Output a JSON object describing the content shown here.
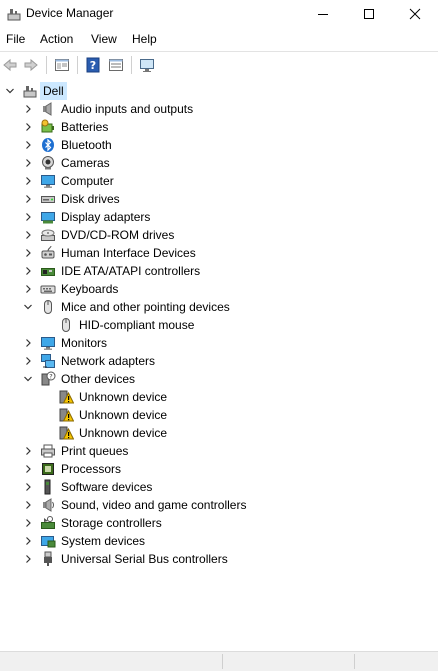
{
  "window": {
    "title": "Device Manager"
  },
  "menu": [
    "File",
    "Action",
    "View",
    "Help"
  ],
  "tree": {
    "root": "Dell",
    "categories": [
      {
        "label": "Audio inputs and outputs",
        "icon": "speaker-icon",
        "expanded": false
      },
      {
        "label": "Batteries",
        "icon": "battery-icon",
        "expanded": false
      },
      {
        "label": "Bluetooth",
        "icon": "bluetooth-icon",
        "expanded": false
      },
      {
        "label": "Cameras",
        "icon": "camera-icon",
        "expanded": false
      },
      {
        "label": "Computer",
        "icon": "computer-icon",
        "expanded": false
      },
      {
        "label": "Disk drives",
        "icon": "disk-drive-icon",
        "expanded": false
      },
      {
        "label": "Display adapters",
        "icon": "display-adapter-icon",
        "expanded": false
      },
      {
        "label": "DVD/CD-ROM drives",
        "icon": "dvd-drive-icon",
        "expanded": false
      },
      {
        "label": "Human Interface Devices",
        "icon": "hid-icon",
        "expanded": false
      },
      {
        "label": "IDE ATA/ATAPI controllers",
        "icon": "ide-controller-icon",
        "expanded": false
      },
      {
        "label": "Keyboards",
        "icon": "keyboard-icon",
        "expanded": false
      },
      {
        "label": "Mice and other pointing devices",
        "icon": "mouse-icon",
        "expanded": true,
        "children": [
          {
            "label": "HID-compliant mouse",
            "icon": "mouse-icon"
          }
        ]
      },
      {
        "label": "Monitors",
        "icon": "monitor-icon",
        "expanded": false
      },
      {
        "label": "Network adapters",
        "icon": "network-adapter-icon",
        "expanded": false
      },
      {
        "label": "Other devices",
        "icon": "unknown-device-icon",
        "expanded": true,
        "children": [
          {
            "label": "Unknown device",
            "icon": "warning-device-icon"
          },
          {
            "label": "Unknown device",
            "icon": "warning-device-icon"
          },
          {
            "label": "Unknown device",
            "icon": "warning-device-icon"
          }
        ]
      },
      {
        "label": "Print queues",
        "icon": "printer-icon",
        "expanded": false
      },
      {
        "label": "Processors",
        "icon": "processor-icon",
        "expanded": false
      },
      {
        "label": "Software devices",
        "icon": "software-device-icon",
        "expanded": false
      },
      {
        "label": "Sound, video and game controllers",
        "icon": "sound-controller-icon",
        "expanded": false
      },
      {
        "label": "Storage controllers",
        "icon": "storage-controller-icon",
        "expanded": false
      },
      {
        "label": "System devices",
        "icon": "system-device-icon",
        "expanded": false
      },
      {
        "label": "Universal Serial Bus controllers",
        "icon": "usb-icon",
        "expanded": false
      }
    ]
  }
}
